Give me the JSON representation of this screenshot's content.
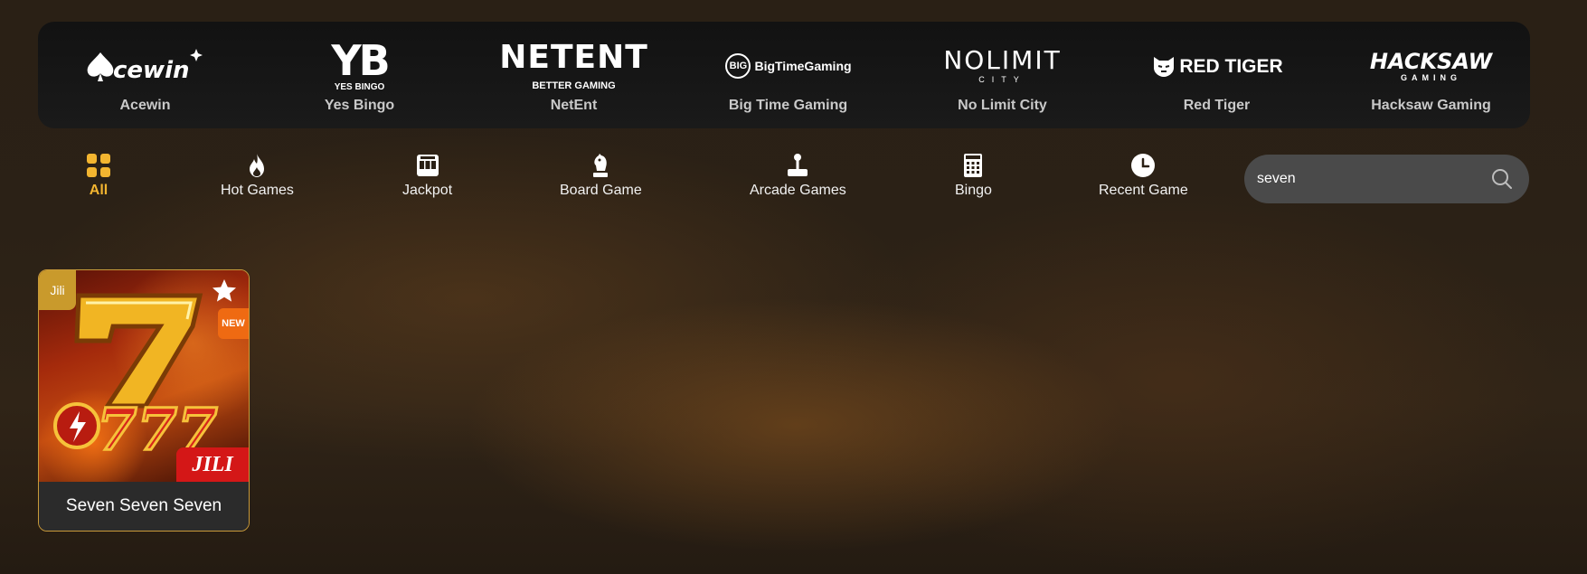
{
  "providers": [
    {
      "logo_text": "Acewin",
      "name": "Acewin"
    },
    {
      "logo_text": "YB",
      "logo_sub": "YES BINGO",
      "name": "Yes Bingo"
    },
    {
      "logo_text": "NETENT",
      "logo_sub": "BETTER GAMING",
      "name": "NetEnt"
    },
    {
      "logo_text": "BigTimeGaming",
      "logo_badge": "BIG",
      "name": "Big Time Gaming"
    },
    {
      "logo_text": "NOLIMIT",
      "logo_sub": "CITY",
      "name": "No Limit City"
    },
    {
      "logo_text": "RED TIGER",
      "name": "Red Tiger"
    },
    {
      "logo_text": "HACKSAW",
      "logo_sub": "GAMING",
      "name": "Hacksaw Gaming"
    }
  ],
  "categories": [
    {
      "label": "All",
      "icon": "grid-icon",
      "active": true
    },
    {
      "label": "Hot Games",
      "icon": "flame-icon"
    },
    {
      "label": "Jackpot",
      "icon": "slot-machine-icon"
    },
    {
      "label": "Board Game",
      "icon": "chess-knight-icon"
    },
    {
      "label": "Arcade Games",
      "icon": "joystick-icon"
    },
    {
      "label": "Bingo",
      "icon": "bingo-card-icon"
    },
    {
      "label": "Recent Game",
      "icon": "clock-icon"
    }
  ],
  "search": {
    "value": "seven",
    "icon": "search-icon"
  },
  "games": [
    {
      "title": "Seven Seven Seven",
      "provider_tag": "Jili",
      "badge": "NEW",
      "brand_mark": "JILI",
      "favorite_icon": "star-icon"
    }
  ],
  "colors": {
    "accent": "#f3b530",
    "tag": "#c99a2c",
    "new_badge": "#ef6a12",
    "search_bg": "#4a4a4a"
  }
}
